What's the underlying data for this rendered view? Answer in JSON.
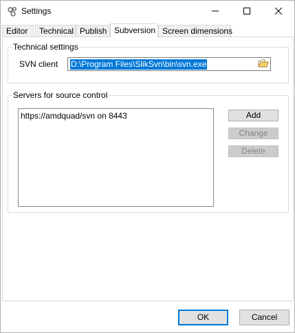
{
  "window": {
    "title": "Settings",
    "controls": {
      "minimize_icon": "minimize-icon",
      "maximize_icon": "maximize-icon",
      "close_icon": "close-icon"
    }
  },
  "tabs": [
    {
      "label": "Editor",
      "active": false
    },
    {
      "label": "Technical",
      "active": false
    },
    {
      "label": "Publish",
      "active": false
    },
    {
      "label": "Subversion",
      "active": true
    },
    {
      "label": "Screen dimensions",
      "active": false
    }
  ],
  "technical_settings": {
    "group_title": "Technical settings",
    "svn_client_label": "SVN client",
    "svn_client_value": "D:\\Program Files\\SlikSvn\\bin\\svn.exe",
    "browse_icon": "folder-open-icon"
  },
  "servers": {
    "group_title": "Servers for source control",
    "items": [
      "https://amdquad/svn on 8443"
    ],
    "add_label": "Add",
    "change_label": "Change",
    "delete_label": "Delete"
  },
  "footer": {
    "ok_label": "OK",
    "cancel_label": "Cancel"
  },
  "colors": {
    "selection": "#0078d7",
    "default_button_border": "#0078d7",
    "disabled_text": "#838383"
  }
}
